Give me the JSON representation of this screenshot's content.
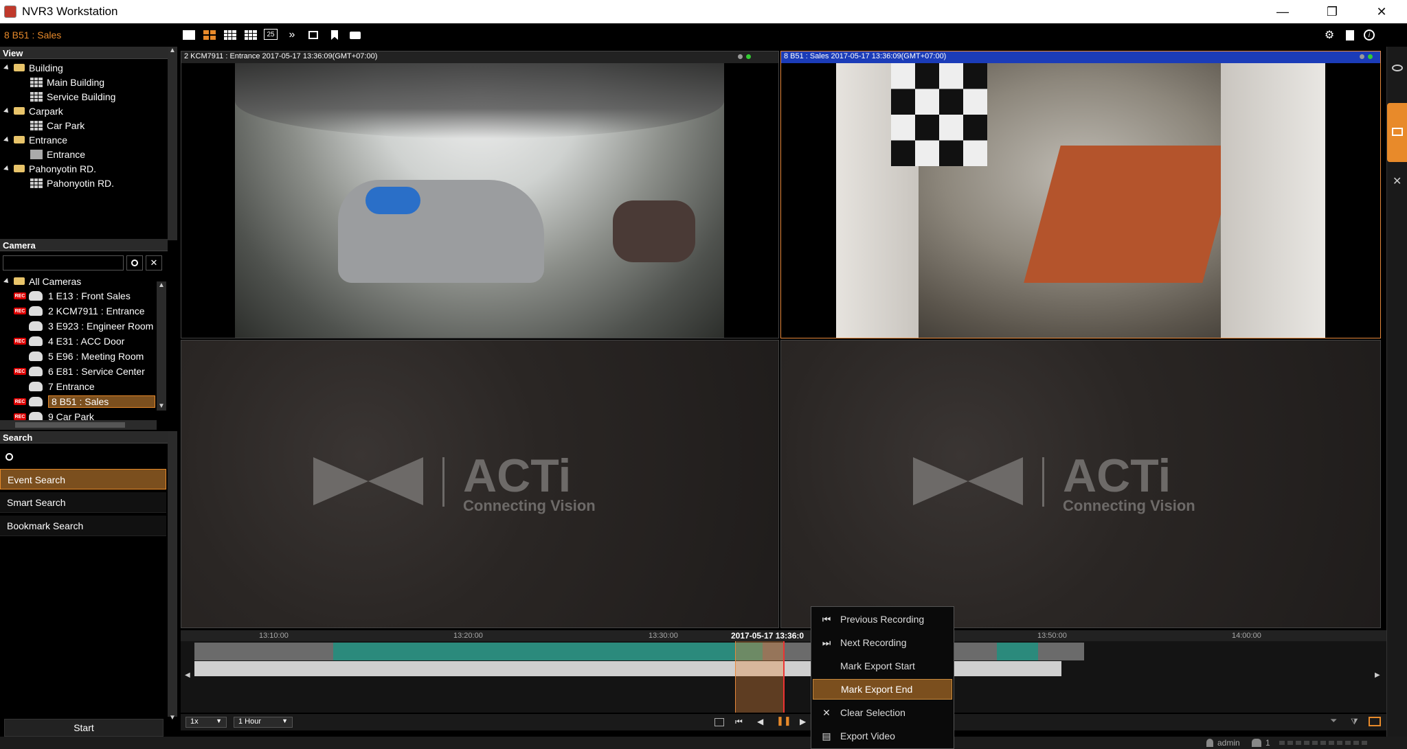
{
  "window": {
    "title": "NVR3 Workstation",
    "minimize": "—",
    "restore": "❐",
    "close": "✕"
  },
  "toolbar": {
    "current_camera": "8 B51 : Sales",
    "layout_25": "25",
    "more": "»"
  },
  "view_panel": {
    "header": "View",
    "items": [
      {
        "type": "folder",
        "label": "Building",
        "indent": 0
      },
      {
        "type": "grid",
        "label": "Main Building",
        "indent": 1
      },
      {
        "type": "grid",
        "label": "Service Building",
        "indent": 1
      },
      {
        "type": "folder",
        "label": "Carpark",
        "indent": 0
      },
      {
        "type": "grid",
        "label": "Car Park",
        "indent": 1
      },
      {
        "type": "folder",
        "label": "Entrance",
        "indent": 0
      },
      {
        "type": "single",
        "label": "Entrance",
        "indent": 1
      },
      {
        "type": "folder",
        "label": "Pahonyotin RD.",
        "indent": 0
      },
      {
        "type": "grid",
        "label": "Pahonyotin RD.",
        "indent": 1
      }
    ]
  },
  "camera_panel": {
    "header": "Camera",
    "search_placeholder": "",
    "root": "All Cameras",
    "cameras": [
      {
        "label": "1 E13 : Front Sales",
        "rec": true,
        "selected": false
      },
      {
        "label": "2 KCM7911 : Entrance",
        "rec": true,
        "selected": false
      },
      {
        "label": "3 E923 : Engineer Room",
        "rec": false,
        "selected": false
      },
      {
        "label": "4 E31 : ACC Door",
        "rec": true,
        "selected": false
      },
      {
        "label": "5 E96 : Meeting Room",
        "rec": false,
        "selected": false
      },
      {
        "label": "6 E81 : Service Center",
        "rec": true,
        "selected": false
      },
      {
        "label": "7 Entrance",
        "rec": false,
        "selected": false
      },
      {
        "label": "8 B51 : Sales",
        "rec": true,
        "selected": true
      },
      {
        "label": "9 Car Park",
        "rec": true,
        "selected": false
      }
    ],
    "rec_badge": "REC"
  },
  "search_panel": {
    "header": "Search",
    "items": [
      "Event Search",
      "Smart Search",
      "Bookmark Search"
    ],
    "active_index": 0
  },
  "start_button": "Start",
  "video": {
    "tiles": [
      {
        "header": "2 KCM7911 : Entrance   2017-05-17 13:36:09(GMT+07:00)"
      },
      {
        "header": "8 B51 : Sales   2017-05-17 13:36:09(GMT+07:00)"
      }
    ],
    "logo_brand": "ACTi",
    "logo_tagline": "Connecting Vision"
  },
  "timeline": {
    "ticks": [
      "13:10:00",
      "13:20:00",
      "13:30:00",
      "13:50:00",
      "14:00:00"
    ],
    "current": "2017-05-17 13:36:0",
    "speed": "1x",
    "range": "1 Hour"
  },
  "context_menu": {
    "items": [
      {
        "label": "Previous Recording",
        "icon": "prev-recording-icon"
      },
      {
        "label": "Next Recording",
        "icon": "next-recording-icon"
      },
      {
        "label": "Mark Export Start",
        "icon": ""
      },
      {
        "label": "Mark Export End",
        "icon": ""
      },
      {
        "label": "Clear Selection",
        "icon": "clear-icon"
      },
      {
        "label": "Export Video",
        "icon": "export-icon"
      }
    ],
    "active_index": 3
  },
  "statusbar": {
    "user": "admin",
    "users_count": "1"
  },
  "colors": {
    "accent": "#e88a2a",
    "selected_bg": "#7b4f1e",
    "active_border": "#e8893c",
    "rec_green": "#2b8a7c"
  }
}
